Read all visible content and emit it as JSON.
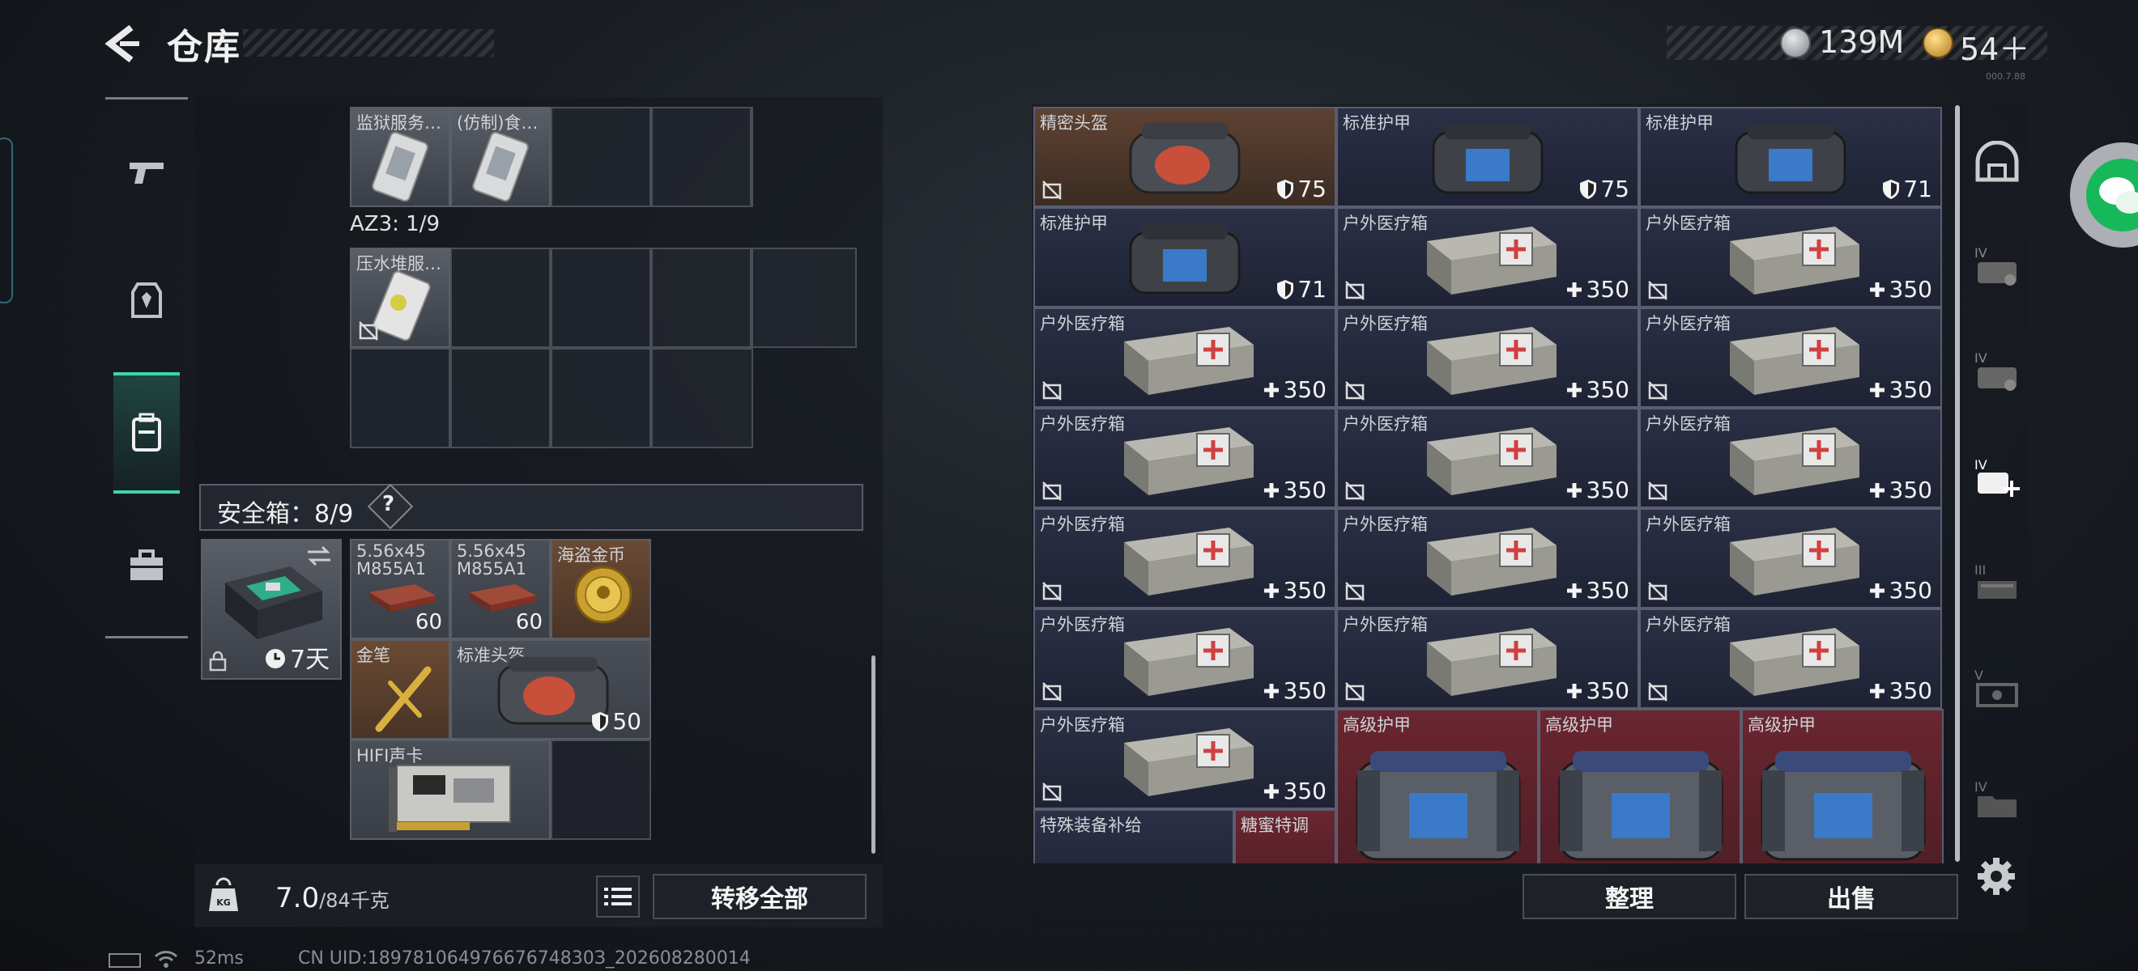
{
  "header": {
    "title": "仓库",
    "silver_amount": "139M",
    "gold_amount": "54＋",
    "version": "000.7.88"
  },
  "left": {
    "top_items": [
      {
        "name": "监狱服务…"
      },
      {
        "name": "(仿制)食…"
      }
    ],
    "section_label": "AZ3: 1/9",
    "az3_items": [
      {
        "name": "压水堆服…"
      }
    ],
    "safebox_label": "安全箱：8/9",
    "help_glyph": "?",
    "safebox_timer": "7天",
    "safebox_items": [
      {
        "name": "5.56x45 M855A1",
        "qty": "60"
      },
      {
        "name": "5.56x45 M855A1",
        "qty": "60"
      },
      {
        "name": "海盗金币",
        "qty": ""
      },
      {
        "name": "金笔",
        "qty": ""
      },
      {
        "name": "标准头盔",
        "qty": "50"
      },
      {
        "name": "HIFI声卡",
        "qty": ""
      }
    ],
    "weight_current": "7.0",
    "weight_max": "/84千克",
    "transfer_label": "转移全部"
  },
  "right": {
    "items": [
      {
        "name": "精密头盔",
        "stat": "75",
        "kind": "helmet",
        "bg": "brown"
      },
      {
        "name": "标准护甲",
        "stat": "75",
        "kind": "armor",
        "bg": "navy"
      },
      {
        "name": "标准护甲",
        "stat": "71",
        "kind": "armor",
        "bg": "navy"
      },
      {
        "name": "标准护甲",
        "stat": "71",
        "kind": "armor",
        "bg": "navy"
      },
      {
        "name": "户外医疗箱",
        "stat": "350",
        "kind": "med",
        "bg": "navy"
      },
      {
        "name": "户外医疗箱",
        "stat": "350",
        "kind": "med",
        "bg": "navy"
      },
      {
        "name": "户外医疗箱",
        "stat": "350",
        "kind": "med",
        "bg": "navy"
      },
      {
        "name": "户外医疗箱",
        "stat": "350",
        "kind": "med",
        "bg": "navy"
      },
      {
        "name": "户外医疗箱",
        "stat": "350",
        "kind": "med",
        "bg": "navy"
      },
      {
        "name": "户外医疗箱",
        "stat": "350",
        "kind": "med",
        "bg": "navy"
      },
      {
        "name": "户外医疗箱",
        "stat": "350",
        "kind": "med",
        "bg": "navy"
      },
      {
        "name": "户外医疗箱",
        "stat": "350",
        "kind": "med",
        "bg": "navy"
      },
      {
        "name": "户外医疗箱",
        "stat": "350",
        "kind": "med",
        "bg": "navy"
      },
      {
        "name": "户外医疗箱",
        "stat": "350",
        "kind": "med",
        "bg": "navy"
      },
      {
        "name": "户外医疗箱",
        "stat": "350",
        "kind": "med",
        "bg": "navy"
      },
      {
        "name": "户外医疗箱",
        "stat": "350",
        "kind": "med",
        "bg": "navy"
      },
      {
        "name": "户外医疗箱",
        "stat": "350",
        "kind": "med",
        "bg": "navy"
      },
      {
        "name": "户外医疗箱",
        "stat": "350",
        "kind": "med",
        "bg": "navy"
      },
      {
        "name": "户外医疗箱",
        "stat": "350",
        "kind": "med",
        "bg": "navy"
      }
    ],
    "big_items": [
      {
        "name": "高级护甲"
      },
      {
        "name": "高级护甲"
      },
      {
        "name": "高级护甲"
      }
    ],
    "partial_items": [
      {
        "name": "特殊装备补给"
      },
      {
        "name": "糖蜜特调"
      }
    ],
    "sort_label": "整理",
    "sell_label": "出售",
    "nav_levels": [
      "",
      "IV",
      "IV",
      "IV",
      "III",
      "V",
      "IV"
    ]
  },
  "status": {
    "ping": "52ms",
    "uid": "CN UID:18978106497667674830З_202608280014"
  },
  "colors": {
    "accent": "#3ed6a8",
    "brown_cell": "#6a4a34",
    "navy_cell": "#2a2e44",
    "red_cell": "#6a2630"
  }
}
